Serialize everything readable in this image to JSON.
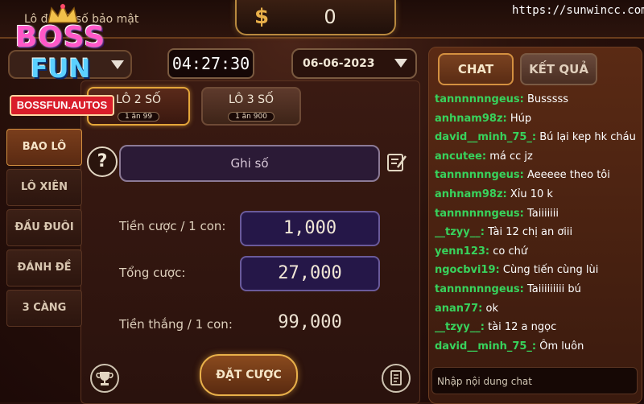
{
  "header": {
    "page_title": "Lô đề xổ số bảo mật",
    "balance": "0",
    "currency_icon": "dollar-icon",
    "url": "https://sunwincc.com/"
  },
  "logo": {
    "line1": "BOSS",
    "line2": "FUN",
    "domain": "BOSSFUN.AUTOS"
  },
  "selectors": {
    "timer": "04:27:30",
    "date": "06-06-2023"
  },
  "tabs": [
    {
      "label": "LÔ 2 SỐ",
      "sub": "1 ăn 99",
      "active": true
    },
    {
      "label": "LÔ 3 SỐ",
      "sub": "1 ăn 900",
      "active": false
    }
  ],
  "sidebar": {
    "items": [
      {
        "label": "BAO LÔ",
        "active": true
      },
      {
        "label": "LÔ XIÊN",
        "active": false
      },
      {
        "label": "ĐẦU ĐUÔI",
        "active": false
      },
      {
        "label": "ĐÁNH ĐỀ",
        "active": false
      },
      {
        "label": "3 CÀNG",
        "active": false
      }
    ]
  },
  "form": {
    "note_placeholder": "Ghi số",
    "bet_per_label": "Tiền cược / 1 con:",
    "bet_per_value": "1,000",
    "total_label": "Tổng cược:",
    "total_value": "27,000",
    "win_label": "Tiền thắng / 1 con:",
    "win_value": "99,000",
    "submit_label": "ĐẶT CƯỢC"
  },
  "chat": {
    "tab_chat": "CHAT",
    "tab_result": "KẾT QUẢ",
    "messages": [
      {
        "user": "tannnnnngeus:",
        "text": "Busssss"
      },
      {
        "user": "anhnam98z:",
        "text": "Húp"
      },
      {
        "user": "david__minh_75_:",
        "text": "Bú lại kep hk cháu"
      },
      {
        "user": "ancutee:",
        "text": "má cc jz"
      },
      {
        "user": "tannnnnngeus:",
        "text": "Aeeeee theo tôi"
      },
      {
        "user": "anhnam98z:",
        "text": "Xỉu 10 k"
      },
      {
        "user": "tannnnnngeus:",
        "text": "Taiiiiiii"
      },
      {
        "user": "__tzyy__:",
        "text": "Tài 12 chị an ơiii"
      },
      {
        "user": "yenn123:",
        "text": "co chứ"
      },
      {
        "user": "ngocbvi19:",
        "text": "Cùng tiến cùng lùi"
      },
      {
        "user": "tannnnnngeus:",
        "text": "Taiiiiiiiii bú"
      },
      {
        "user": "anan77:",
        "text": "ok"
      },
      {
        "user": "__tzyy__:",
        "text": "tài 12 a ngọc"
      },
      {
        "user": "david__minh_75_:",
        "text": "Ôm luôn"
      }
    ],
    "input_placeholder": "Nhập nội dung chat"
  },
  "colors": {
    "accent_gold": "#e4a63a",
    "chat_username": "#38d25c",
    "logo_pink": "#ff58c8",
    "logo_blue": "#5bd0ff",
    "domain_red": "#d91d2a"
  }
}
